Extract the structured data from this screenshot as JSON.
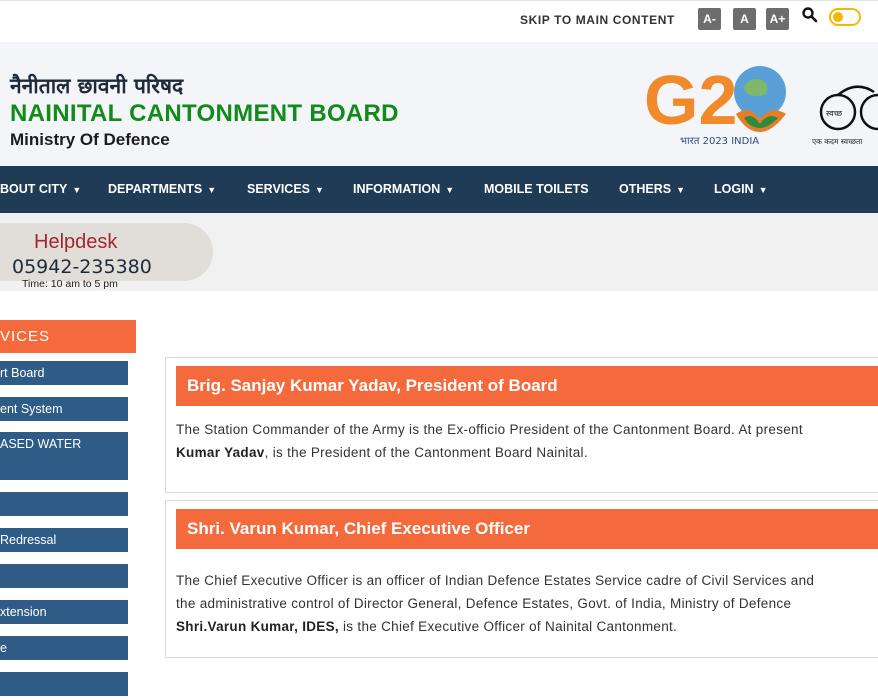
{
  "topbar": {
    "skip_label": "SKIP TO MAIN CONTENT",
    "font_smaller": "A-",
    "font_normal": "A",
    "font_larger": "A+"
  },
  "header": {
    "hindi_title": "नैनीताल छावनी परिषद",
    "board_name": "NAINITAL CANTONMENT BOARD",
    "ministry": "Ministry Of Defence",
    "g20_text": "G20",
    "g20_sub": "भारत 2023 INDIA",
    "swachh_label": "स्वच्छ",
    "swachh_caption": "एक कदम स्वच्छता"
  },
  "nav": {
    "items": [
      {
        "label": "BOUT CITY",
        "dropdown": true
      },
      {
        "label": "DEPARTMENTS",
        "dropdown": true
      },
      {
        "label": "SERVICES",
        "dropdown": true
      },
      {
        "label": "INFORMATION",
        "dropdown": true
      },
      {
        "label": "MOBILE TOILETS",
        "dropdown": false
      },
      {
        "label": "OTHERS",
        "dropdown": true
      },
      {
        "label": "LOGIN",
        "dropdown": true
      }
    ]
  },
  "helpdesk": {
    "title": "Helpdesk",
    "phone": "05942-235380",
    "time": "Time: 10 am to 5 pm"
  },
  "services": {
    "heading": "VICES",
    "items": [
      "rt Board",
      "ent System",
      "ASED WATER",
      "",
      "Redressal",
      "",
      "xtension",
      "e",
      ""
    ]
  },
  "cards": [
    {
      "title": "Brig. Sanjay Kumar Yadav, President of Board",
      "line1": "The Station Commander of the Army is the Ex-officio President of the Cantonment Board. At present",
      "bold2": "Kumar Yadav",
      "line2": ", is the President of the Cantonment Board Nainital."
    },
    {
      "title": "Shri. Varun Kumar, Chief Executive Officer",
      "line1": "The Chief Executive Officer is an officer of Indian Defence Estates Service cadre of Civil Services and",
      "line2": "the administrative control of Director General, Defence Estates, Govt. of India, Ministry of Defence",
      "bold3": "Shri.Varun Kumar, IDES,",
      "line3": " is the Chief Executive Officer of Nainital Cantonment."
    }
  ],
  "colors": {
    "nav_bg": "#1f3b55",
    "accent_orange": "#f46a3c",
    "board_green": "#118b1a",
    "sidebar_blue": "#2f5b87"
  }
}
